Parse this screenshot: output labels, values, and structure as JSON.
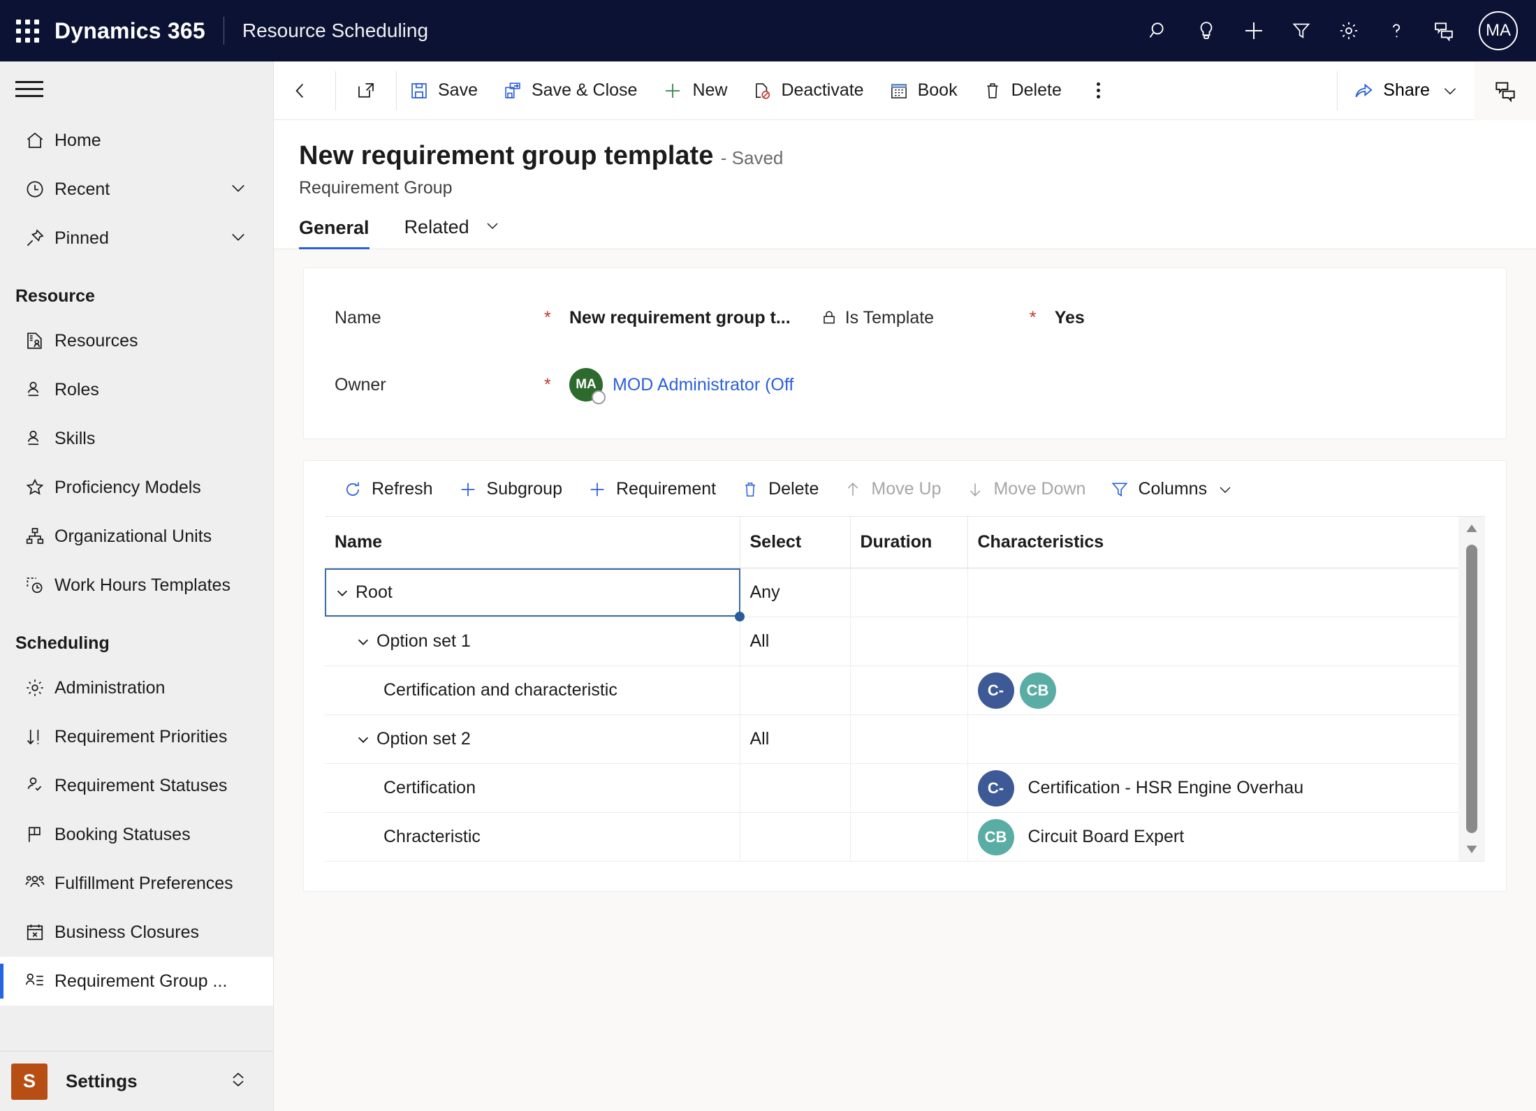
{
  "topbar": {
    "waffle": "app-launcher",
    "brand": "Dynamics 365",
    "app_name": "Resource Scheduling",
    "icons": [
      {
        "name": "search-icon",
        "label": "Search"
      },
      {
        "name": "lightbulb-icon",
        "label": "Insights"
      },
      {
        "name": "plus-icon",
        "label": "Quick create"
      },
      {
        "name": "filter-icon",
        "label": "Filter"
      },
      {
        "name": "gear-icon",
        "label": "Settings"
      },
      {
        "name": "help-icon",
        "label": "Help"
      },
      {
        "name": "feedback-icon",
        "label": "Feedback"
      }
    ],
    "avatar_initials": "MA"
  },
  "sidebar": {
    "hamburger": "site-map-toggle",
    "items": [
      {
        "label": "Home",
        "icon": "home-icon",
        "chevron": false,
        "selected": false
      },
      {
        "label": "Recent",
        "icon": "clock-icon",
        "chevron": true,
        "selected": false
      },
      {
        "label": "Pinned",
        "icon": "pin-icon",
        "chevron": true,
        "selected": false
      }
    ],
    "groups": [
      {
        "title": "Resource",
        "items": [
          {
            "label": "Resources",
            "icon": "resource-card-icon",
            "selected": false
          },
          {
            "label": "Roles",
            "icon": "person-badge-icon",
            "selected": false
          },
          {
            "label": "Skills",
            "icon": "person-badge-icon",
            "selected": false
          },
          {
            "label": "Proficiency Models",
            "icon": "star-icon",
            "selected": false
          },
          {
            "label": "Organizational Units",
            "icon": "org-chart-icon",
            "selected": false
          },
          {
            "label": "Work Hours Templates",
            "icon": "clock-dashed-icon",
            "selected": false
          }
        ]
      },
      {
        "title": "Scheduling",
        "items": [
          {
            "label": "Administration",
            "icon": "gear-icon",
            "selected": false
          },
          {
            "label": "Requirement Priorities",
            "icon": "sort-arrows-icon",
            "selected": false
          },
          {
            "label": "Requirement Statuses",
            "icon": "people-check-icon",
            "selected": false
          },
          {
            "label": "Booking Statuses",
            "icon": "flag-icon",
            "selected": false
          },
          {
            "label": "Fulfillment Preferences",
            "icon": "people-icon",
            "selected": false
          },
          {
            "label": "Business Closures",
            "icon": "calendar-x-icon",
            "selected": false
          },
          {
            "label": "Requirement Group ...",
            "icon": "person-list-icon",
            "selected": true
          }
        ]
      }
    ],
    "settings": {
      "tile": "S",
      "label": "Settings",
      "chevron": "expand-collapse-icon"
    }
  },
  "commandbar": {
    "back": "back-arrow-icon",
    "popout": "pop-out-icon",
    "buttons": [
      {
        "label": "Save",
        "icon": "save-icon"
      },
      {
        "label": "Save & Close",
        "icon": "save-close-icon"
      },
      {
        "label": "New",
        "icon": "plus-icon"
      },
      {
        "label": "Deactivate",
        "icon": "deactivate-icon"
      },
      {
        "label": "Book",
        "icon": "calendar-icon"
      },
      {
        "label": "Delete",
        "icon": "trash-icon"
      }
    ],
    "overflow": "more-commands-icon",
    "share": {
      "label": "Share",
      "icon": "share-icon",
      "chevron": "chevron-down-icon"
    },
    "right_panel": "panel-toggle-icon"
  },
  "record": {
    "title": "New requirement group template",
    "saved_state": "- Saved",
    "entity": "Requirement Group"
  },
  "tabs": [
    {
      "label": "General",
      "active": true,
      "chevron": false
    },
    {
      "label": "Related",
      "active": false,
      "chevron": true
    }
  ],
  "form": {
    "name": {
      "label": "Name",
      "required": "*",
      "value": "New requirement group t..."
    },
    "is_template": {
      "label": "Is Template",
      "icon": "lock-icon",
      "required": "*",
      "value": "Yes"
    },
    "owner": {
      "label": "Owner",
      "required": "*",
      "avatar": "MA",
      "value": "MOD Administrator (Off"
    }
  },
  "grid": {
    "toolbar": [
      {
        "label": "Refresh",
        "icon": "refresh-icon",
        "disabled": false
      },
      {
        "label": "Subgroup",
        "icon": "plus-icon",
        "disabled": false
      },
      {
        "label": "Requirement",
        "icon": "plus-icon",
        "disabled": false
      },
      {
        "label": "Delete",
        "icon": "trash-icon",
        "disabled": false
      },
      {
        "label": "Move Up",
        "icon": "arrow-up-icon",
        "disabled": true
      },
      {
        "label": "Move Down",
        "icon": "arrow-down-icon",
        "disabled": true
      },
      {
        "label": "Columns",
        "icon": "filter-icon",
        "disabled": false,
        "chevron": true
      }
    ],
    "columns": [
      "Name",
      "Select",
      "Duration",
      "Characteristics"
    ],
    "rows": [
      {
        "name": "Root",
        "indent": 0,
        "twisty": true,
        "select": "Any",
        "duration": "",
        "characteristics": [],
        "char_label": "",
        "selected": true
      },
      {
        "name": "Option set 1",
        "indent": 1,
        "twisty": true,
        "select": "All",
        "duration": "",
        "characteristics": [],
        "char_label": "",
        "selected": false
      },
      {
        "name": "Certification and characteristic",
        "indent": 2,
        "twisty": false,
        "select": "",
        "duration": "",
        "characteristics": [
          {
            "initials": "C-",
            "color": "#3d5a96"
          },
          {
            "initials": "CB",
            "color": "#5aada4"
          }
        ],
        "char_label": "",
        "selected": false
      },
      {
        "name": "Option set 2",
        "indent": 1,
        "twisty": true,
        "select": "All",
        "duration": "",
        "characteristics": [],
        "char_label": "",
        "selected": false
      },
      {
        "name": "Certification",
        "indent": 2,
        "twisty": false,
        "select": "",
        "duration": "",
        "characteristics": [
          {
            "initials": "C-",
            "color": "#3d5a96"
          }
        ],
        "char_label": "Certification - HSR Engine Overhau",
        "selected": false
      },
      {
        "name": "Chracteristic",
        "indent": 2,
        "twisty": false,
        "select": "",
        "duration": "",
        "characteristics": [
          {
            "initials": "CB",
            "color": "#5aada4"
          }
        ],
        "char_label": "Circuit Board Expert",
        "selected": false
      }
    ],
    "scrollbar": {
      "up": "scroll-up-arrow",
      "down": "scroll-down-arrow"
    }
  },
  "colors": {
    "nav_bg": "#0b1233",
    "accent": "#2b5fd9",
    "required": "#c0392b",
    "settings_tile": "#b74f15",
    "owner_avatar": "#2d6a2d"
  }
}
